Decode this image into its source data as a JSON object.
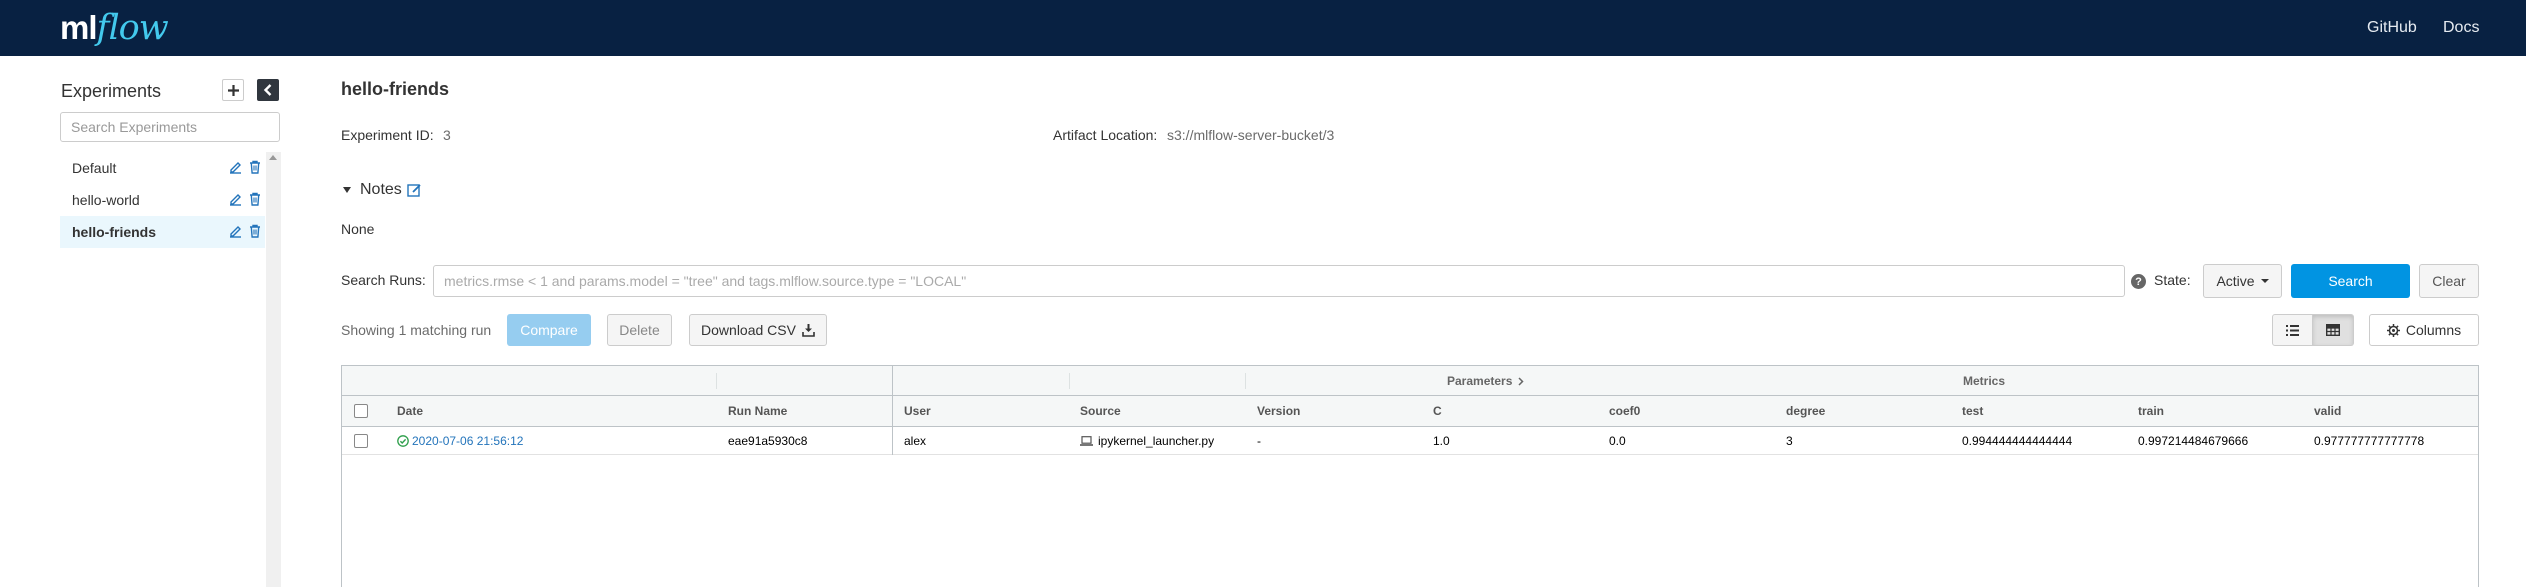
{
  "header": {
    "logo_ml": "ml",
    "logo_flow": "flow",
    "links": [
      "GitHub",
      "Docs"
    ]
  },
  "sidebar": {
    "title": "Experiments",
    "search_placeholder": "Search Experiments",
    "experiments": [
      {
        "name": "Default",
        "active": false
      },
      {
        "name": "hello-world",
        "active": false
      },
      {
        "name": "hello-friends",
        "active": true
      }
    ]
  },
  "experiment": {
    "name": "hello-friends",
    "id_label": "Experiment ID:",
    "id_value": "3",
    "artifact_label": "Artifact Location:",
    "artifact_value": "s3://mlflow-server-bucket/3",
    "notes_label": "Notes",
    "notes_value": "None"
  },
  "search": {
    "label": "Search Runs:",
    "placeholder": "metrics.rmse < 1 and params.model = \"tree\" and tags.mlflow.source.type = \"LOCAL\"",
    "state_label": "State:",
    "state_value": "Active",
    "search_button": "Search",
    "clear_button": "Clear"
  },
  "toolbar": {
    "showing_text": "Showing 1 matching run",
    "compare": "Compare",
    "delete": "Delete",
    "download_csv": "Download CSV",
    "columns": "Columns"
  },
  "grid": {
    "groups": {
      "parameters": "Parameters",
      "metrics": "Metrics"
    },
    "headers": {
      "date": "Date",
      "run_name": "Run Name",
      "user": "User",
      "source": "Source",
      "version": "Version",
      "C": "C",
      "coef0": "coef0",
      "degree": "degree",
      "test": "test",
      "train": "train",
      "valid": "valid"
    },
    "rows": [
      {
        "date": "2020-07-06 21:56:12",
        "run_name": "eae91a5930c8",
        "user": "alex",
        "source": "ipykernel_launcher.py",
        "version": "-",
        "C": "1.0",
        "coef0": "0.0",
        "degree": "3",
        "test": "0.994444444444444",
        "train": "0.997214484679666",
        "valid": "0.977777777777778"
      }
    ]
  },
  "colors": {
    "header_bg": "#082142",
    "logo_accent": "#43c9ed",
    "primary": "#0194e2",
    "success": "#2e9f4b",
    "link": "#2374bb"
  }
}
